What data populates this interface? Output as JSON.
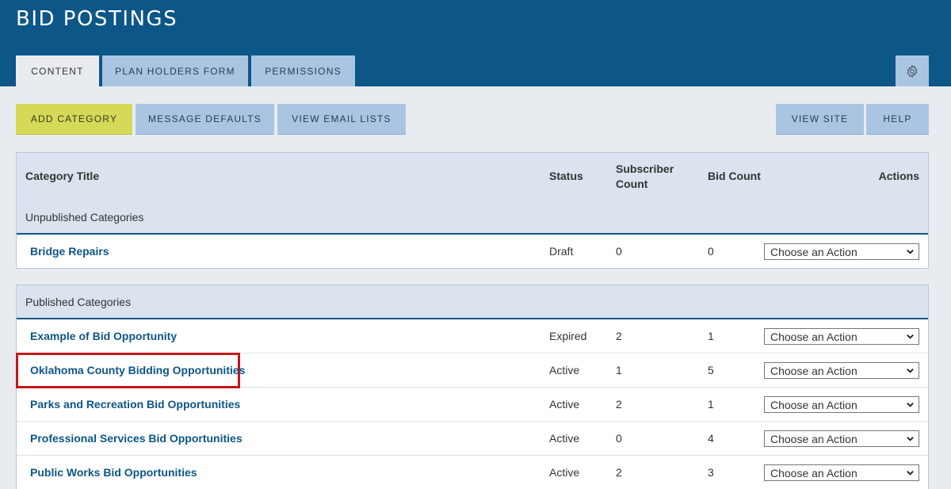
{
  "header": {
    "title": "BID POSTINGS",
    "tabs": [
      {
        "label": "CONTENT"
      },
      {
        "label": "PLAN HOLDERS FORM"
      },
      {
        "label": "PERMISSIONS"
      }
    ],
    "settings_icon": "gear-icon"
  },
  "toolbar": {
    "add_category": "ADD CATEGORY",
    "message_defaults": "MESSAGE DEFAULTS",
    "view_email_lists": "VIEW EMAIL LISTS",
    "view_site": "VIEW SITE",
    "help": "HELP"
  },
  "table": {
    "columns": {
      "title": "Category Title",
      "status": "Status",
      "subscriber_line1": "Subscriber",
      "subscriber_line2": "Count",
      "bid_count": "Bid Count",
      "actions": "Actions"
    },
    "unpublished_label": "Unpublished Categories",
    "published_label": "Published Categories",
    "unpublished": [
      {
        "title": "Bridge Repairs",
        "status": "Draft",
        "subscribers": "0",
        "bids": "0",
        "action": "Choose an Action"
      }
    ],
    "published": [
      {
        "title": "Example of Bid Opportunity",
        "status": "Expired",
        "subscribers": "2",
        "bids": "1",
        "action": "Choose an Action"
      },
      {
        "title": "Oklahoma County Bidding Opportunities",
        "status": "Active",
        "subscribers": "1",
        "bids": "5",
        "action": "Choose an Action"
      },
      {
        "title": "Parks and Recreation Bid Opportunities",
        "status": "Active",
        "subscribers": "2",
        "bids": "1",
        "action": "Choose an Action"
      },
      {
        "title": "Professional Services Bid Opportunities",
        "status": "Active",
        "subscribers": "0",
        "bids": "4",
        "action": "Choose an Action"
      },
      {
        "title": "Public Works Bid Opportunities",
        "status": "Active",
        "subscribers": "2",
        "bids": "3",
        "action": "Choose an Action"
      }
    ]
  },
  "colors": {
    "header_bg": "#0d5688",
    "tab_bg": "#a9c5e2",
    "primary_button": "#d4d957",
    "highlight_border": "#c4161c",
    "link": "#0d5688"
  }
}
